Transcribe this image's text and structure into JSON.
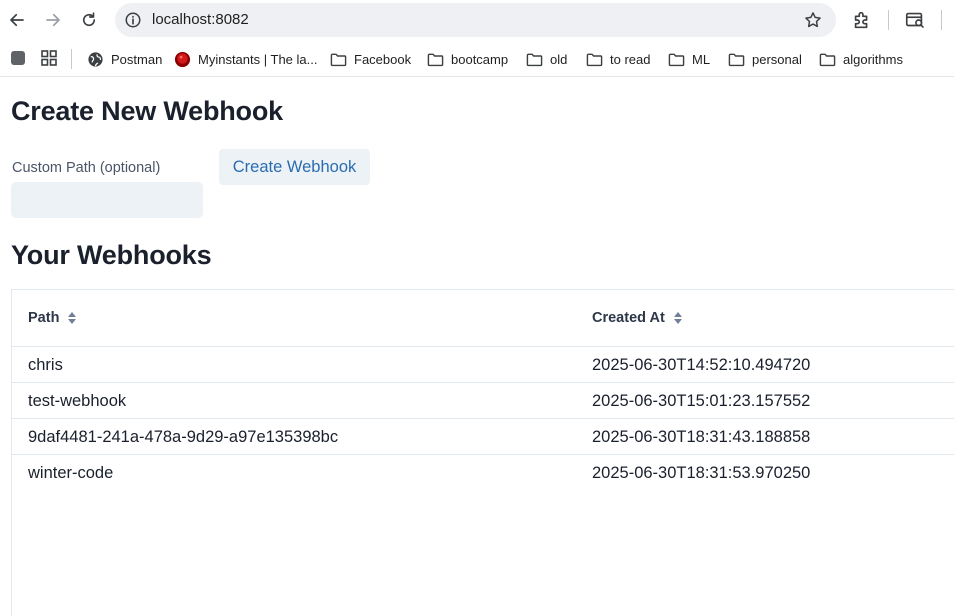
{
  "browser": {
    "url": "localhost:8082",
    "bookmarks": [
      {
        "label": "Postman",
        "icon": "globe-icon"
      },
      {
        "label": "Myinstants | The la...",
        "icon": "myinstants-icon"
      },
      {
        "label": "Facebook",
        "icon": "folder-icon"
      },
      {
        "label": "bootcamp",
        "icon": "folder-icon"
      },
      {
        "label": "old",
        "icon": "folder-icon"
      },
      {
        "label": "to read",
        "icon": "folder-icon"
      },
      {
        "label": "ML",
        "icon": "folder-icon"
      },
      {
        "label": "personal",
        "icon": "folder-icon"
      },
      {
        "label": "algorithms",
        "icon": "folder-icon"
      }
    ]
  },
  "create": {
    "title": "Create New Webhook",
    "path_label": "Custom Path (optional)",
    "path_value": "",
    "button_label": "Create Webhook"
  },
  "list": {
    "title": "Your Webhooks",
    "columns": {
      "path": "Path",
      "created_at": "Created At"
    },
    "rows": [
      {
        "path": "chris",
        "created_at": "2025-06-30T14:52:10.494720"
      },
      {
        "path": "test-webhook",
        "created_at": "2025-06-30T15:01:23.157552"
      },
      {
        "path": "9daf4481-241a-478a-9d29-a97e135398bc",
        "created_at": "2025-06-30T18:31:43.188858"
      },
      {
        "path": "winter-code",
        "created_at": "2025-06-30T18:31:53.970250"
      }
    ]
  },
  "colors": {
    "accent": "#2b6cb0",
    "button_bg": "#edf2f7",
    "heading": "#1a202c"
  }
}
